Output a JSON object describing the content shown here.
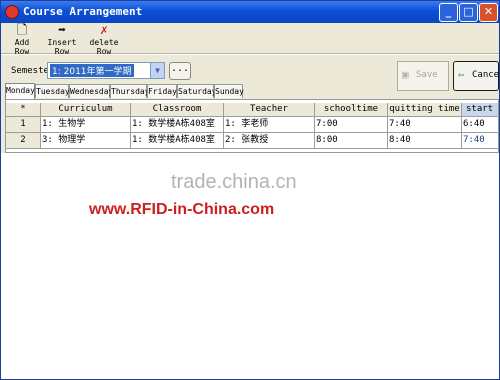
{
  "window": {
    "title": "Course Arrangement"
  },
  "toolbar": {
    "add_row": "Add Row",
    "insert_row": "Insert Row",
    "delete_row": "delete Row"
  },
  "semester": {
    "label": "Semester",
    "selected": "1: 2011年第一学期",
    "browse": "..."
  },
  "actions": {
    "save": "Save",
    "cancel": "Cancel"
  },
  "tabs": [
    "Monday",
    "Tuesday",
    "Wednesday",
    "Thursday",
    "Friday",
    "Saturday",
    "Sunday"
  ],
  "active_tab": "Monday",
  "grid": {
    "row_header": "*",
    "columns": [
      "Curriculum",
      "Classroom",
      "Teacher",
      "schooltime",
      "quitting time",
      "start"
    ],
    "rows": [
      {
        "num": "1",
        "cells": [
          "1: 生物学",
          "1: 数学楼A栋408室",
          "1: 李老师",
          "7:00",
          "7:40",
          "6:40"
        ]
      },
      {
        "num": "2",
        "cells": [
          "3: 物理学",
          "1: 数学楼A栋408室",
          "2: 张教授",
          "8:00",
          "8:40",
          "7:40"
        ]
      }
    ]
  },
  "watermarks": {
    "site": "trade.china.cn",
    "brand": "www.RFID-in-China.com"
  },
  "colors": {
    "title_bar": "#0a4fd6",
    "selection": "#316ac5",
    "watermark_red": "#cc1f1f"
  }
}
